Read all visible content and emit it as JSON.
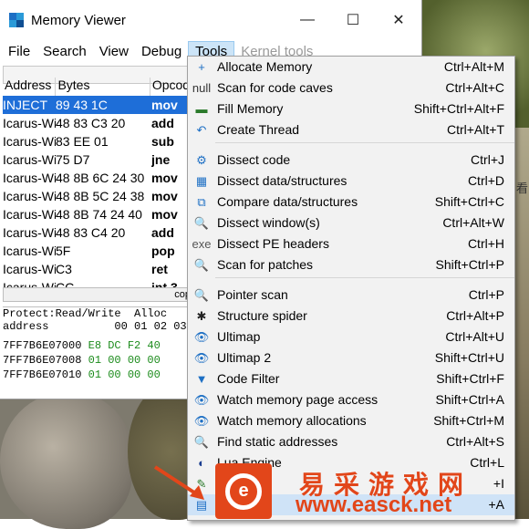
{
  "window": {
    "title": "Memory Viewer",
    "buttons": {
      "minimize": "—",
      "maximize": "☐",
      "close": "✕"
    }
  },
  "menubar": [
    {
      "label": "File",
      "state": "normal"
    },
    {
      "label": "Search",
      "state": "normal"
    },
    {
      "label": "View",
      "state": "normal"
    },
    {
      "label": "Debug",
      "state": "normal"
    },
    {
      "label": "Tools",
      "state": "active"
    },
    {
      "label": "Kernel tools",
      "state": "disabled"
    }
  ],
  "disasm": {
    "headers": [
      "Address",
      "Bytes",
      "Opcode"
    ],
    "rows": [
      {
        "address": "INJECT",
        "bytes": "89 43 1C",
        "opcode": "mov"
      },
      {
        "address": "Icarus-Wi",
        "bytes": "48 83 C3 20",
        "opcode": "add"
      },
      {
        "address": "Icarus-Wi",
        "bytes": "83 EE 01",
        "opcode": "sub"
      },
      {
        "address": "Icarus-Wi",
        "bytes": "75 D7",
        "opcode": "jne"
      },
      {
        "address": "Icarus-Wi",
        "bytes": "48 8B 6C 24 30",
        "opcode": "mov"
      },
      {
        "address": "Icarus-Wi",
        "bytes": "48 8B 5C 24 38",
        "opcode": "mov"
      },
      {
        "address": "Icarus-Wi",
        "bytes": "48 8B 74 24 40",
        "opcode": "mov"
      },
      {
        "address": "Icarus-Wi",
        "bytes": "48 83 C4 20",
        "opcode": "add"
      },
      {
        "address": "Icarus-Wi",
        "bytes": "5F",
        "opcode": "pop"
      },
      {
        "address": "Icarus-Wi",
        "bytes": "C3",
        "opcode": "ret"
      },
      {
        "address": "Icarus-Wi",
        "bytes": "CC",
        "opcode": "int 3"
      }
    ],
    "scroll_text": "cop"
  },
  "hex": {
    "protect_line": "Protect:Read/Write  Alloc",
    "header_line": "address          00 01 02 03",
    "rows": [
      {
        "address": "7FF7B6E07000",
        "bytes": "E8 DC F2 40"
      },
      {
        "address": "7FF7B6E07008",
        "bytes": "01 00 00 00"
      },
      {
        "address": "7FF7B6E07010",
        "bytes": "01 00 00 00"
      }
    ]
  },
  "tools_menu": {
    "groups": [
      [
        {
          "icon": "plus-box-icon",
          "glyph": "+",
          "label": "Allocate Memory",
          "shortcut": "Ctrl+Alt+M"
        },
        {
          "icon": "null-scan-icon",
          "glyph": "null",
          "label": "Scan for code caves",
          "shortcut": "Ctrl+Alt+C"
        },
        {
          "icon": "fill-memory-icon",
          "glyph": "▬",
          "label": "Fill Memory",
          "shortcut": "Shift+Ctrl+Alt+F"
        },
        {
          "icon": "thread-icon",
          "glyph": "↶",
          "label": "Create Thread",
          "shortcut": "Ctrl+Alt+T"
        }
      ],
      [
        {
          "icon": "dissect-code-icon",
          "glyph": "⚙",
          "label": "Dissect code",
          "shortcut": "Ctrl+J"
        },
        {
          "icon": "data-structures-icon",
          "glyph": "▦",
          "label": "Dissect data/structures",
          "shortcut": "Ctrl+D"
        },
        {
          "icon": "compare-icon",
          "glyph": "⧉",
          "label": "Compare data/structures",
          "shortcut": "Shift+Ctrl+C"
        },
        {
          "icon": "window-search-icon",
          "glyph": "🔍",
          "label": "Dissect window(s)",
          "shortcut": "Ctrl+Alt+W"
        },
        {
          "icon": "pe-header-icon",
          "glyph": "exe",
          "label": "Dissect PE headers",
          "shortcut": "Ctrl+H"
        },
        {
          "icon": "patch-scan-icon",
          "glyph": "🔍",
          "label": "Scan for patches",
          "shortcut": "Shift+Ctrl+P"
        }
      ],
      [
        {
          "icon": "pointer-scan-icon",
          "glyph": "🔍",
          "label": "Pointer scan",
          "shortcut": "Ctrl+P"
        },
        {
          "icon": "spider-icon",
          "glyph": "✱",
          "label": "Structure spider",
          "shortcut": "Ctrl+Alt+P"
        },
        {
          "icon": "ultimap-icon",
          "glyph": "👁",
          "label": "Ultimap",
          "shortcut": "Ctrl+Alt+U"
        },
        {
          "icon": "ultimap2-icon",
          "glyph": "👁",
          "label": "Ultimap 2",
          "shortcut": "Shift+Ctrl+U"
        },
        {
          "icon": "filter-icon",
          "glyph": "▼",
          "label": "Code Filter",
          "shortcut": "Shift+Ctrl+F"
        },
        {
          "icon": "eye-icon",
          "glyph": "👁",
          "label": "Watch memory page access",
          "shortcut": "Shift+Ctrl+A"
        },
        {
          "icon": "eye-icon",
          "glyph": "👁",
          "label": "Watch memory allocations",
          "shortcut": "Shift+Ctrl+M"
        },
        {
          "icon": "find-static-icon",
          "glyph": "🔍",
          "label": "Find static addresses",
          "shortcut": "Ctrl+Alt+S"
        },
        {
          "icon": "lua-icon",
          "glyph": "◐",
          "label": "Lua Engine",
          "shortcut": "Ctrl+L"
        },
        {
          "icon": "inject-icon",
          "glyph": "✎",
          "label": "",
          "shortcut": "+I"
        },
        {
          "icon": "assemble-icon",
          "glyph": "▤",
          "label": "embl",
          "shortcut": "+A"
        }
      ]
    ]
  },
  "watermark": {
    "cn": "易采游戏网",
    "url": "www.easck.net"
  },
  "side_text": "看"
}
